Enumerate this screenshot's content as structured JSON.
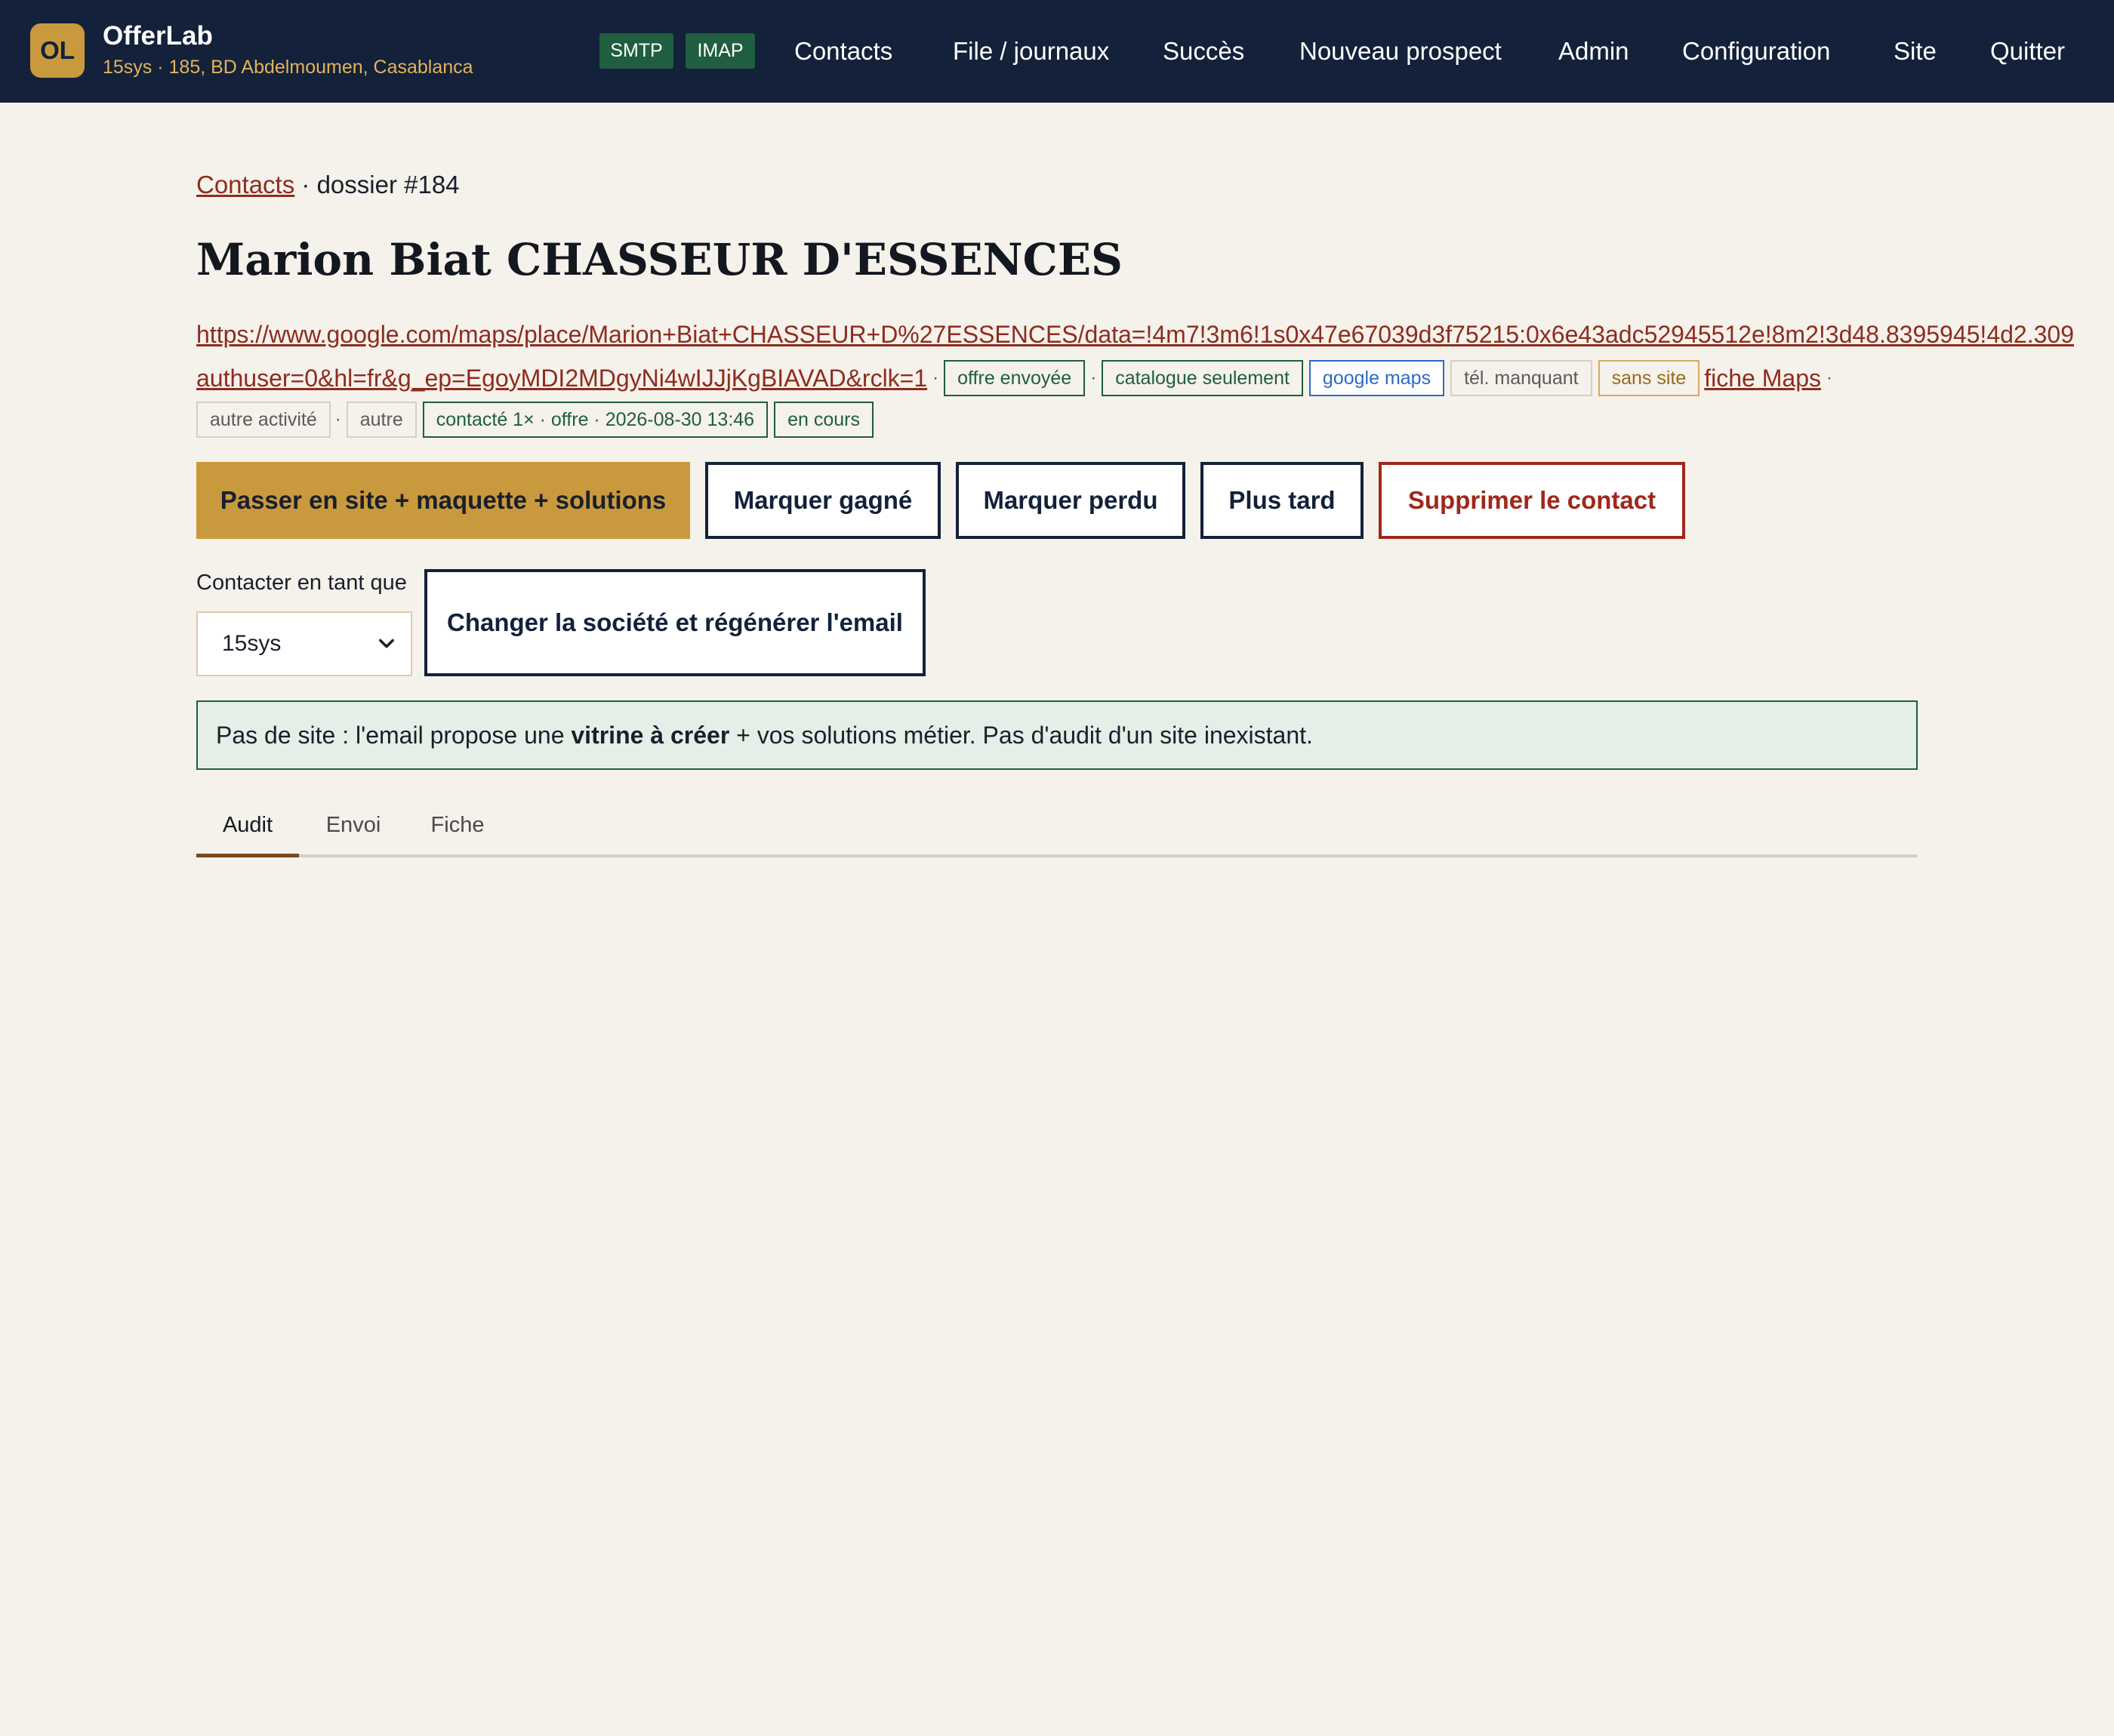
{
  "header": {
    "logo_text": "OL",
    "app_name": "OfferLab",
    "subtitle": "15sys · 185, BD Abdelmoumen, Casablanca",
    "badges": [
      "SMTP",
      "IMAP"
    ],
    "nav": [
      "Contacts",
      "File / journaux",
      "Succès",
      "Nouveau prospect",
      "Admin",
      "Configuration",
      "Site",
      "Quitter"
    ]
  },
  "breadcrumb": {
    "link": "Contacts",
    "separator": "·",
    "current": "dossier #184"
  },
  "title": "Marion Biat CHASSEUR D'ESSENCES",
  "maps_url": {
    "line1": "https://www.google.com/maps/place/Marion+Biat+CHASSEUR+D%27ESSENCES/data=!4m7!3m6!1s0x47e67039d3f75215:0x6e43adc52945512e!8m2!3d48.8395945!4d2.309",
    "line2": "authuser=0&hl=fr&g_ep=EgoyMDI2MDgyNi4wIJJjKgBIAVAD&rclk=1"
  },
  "tags_row1": [
    "offre envoyée",
    "catalogue seulement",
    "google maps",
    "tél. manquant",
    "sans site"
  ],
  "maps_link": "fiche Maps",
  "tags_row2": [
    "autre activité",
    "autre",
    "contacté 1× · offre · 2026-08-30 13:46",
    "en cours"
  ],
  "actions": {
    "primary": "Passer en site + maquette + solutions",
    "won": "Marquer gagné",
    "lost": "Marquer perdu",
    "later": "Plus tard",
    "delete": "Supprimer le contact"
  },
  "contact_as": {
    "label": "Contacter en tant que",
    "value": "15sys",
    "regen_button": "Changer la société et régénérer l'email"
  },
  "notice": {
    "before": "Pas de site : l'email propose une ",
    "bold": "vitrine à créer",
    "after": " + vos solutions métier. Pas d'audit d'un site inexistant."
  },
  "tabs": [
    "Audit",
    "Envoi",
    "Fiche"
  ],
  "active_tab": "Audit",
  "colors": {
    "header_bg": "#13213a",
    "accent_gold": "#c99a3d",
    "link_red": "#8e2c1e",
    "success_green": "#1f5e3e",
    "page_bg": "#f5f1eb"
  }
}
